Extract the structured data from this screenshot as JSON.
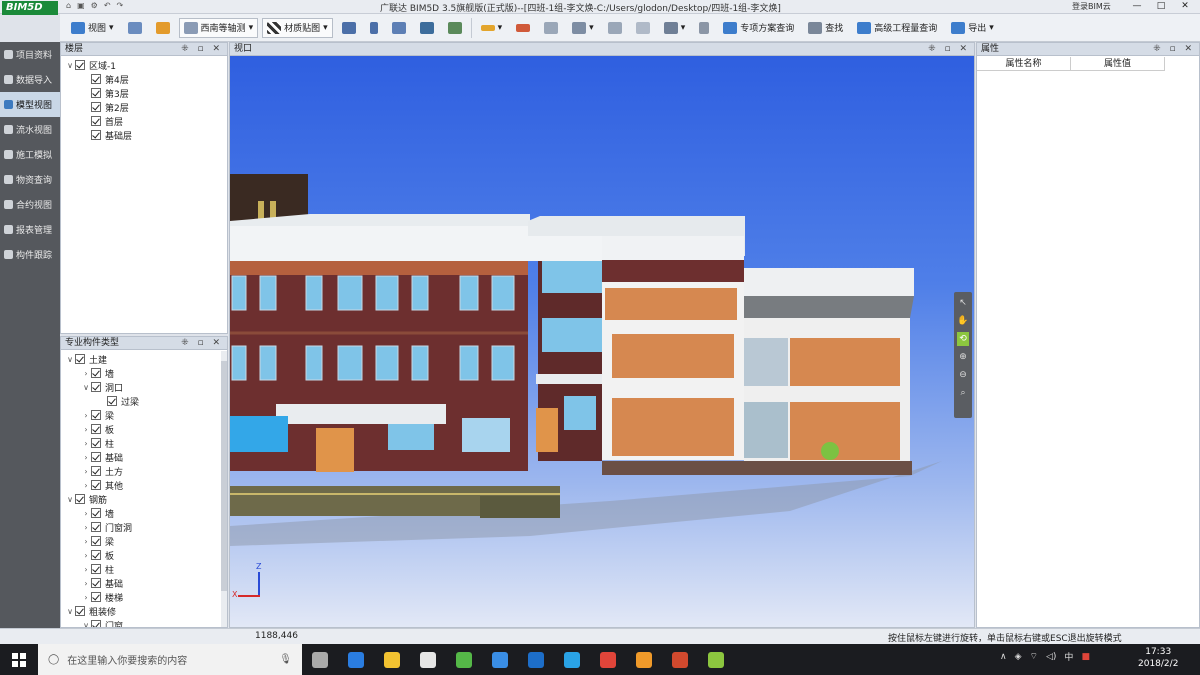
{
  "app": {
    "logo": "BIM5D",
    "window_title": "广联达 BIM5D 3.5旗舰版(正式版)--[四班-1组-李文焕-C:/Users/glodon/Desktop/四班-1组-李文焕]",
    "cloud_login": "登录BIM云",
    "win_controls": [
      "—",
      "□",
      "✕"
    ]
  },
  "toolbar": {
    "view_label": "视图",
    "axis_view": "西南等轴测",
    "material_texture": "材质贴图",
    "special_query": "专项方案查询",
    "find": "查找",
    "advanced_query": "高级工程量查询",
    "export": "导出"
  },
  "left_nav": [
    {
      "label": "项目资料",
      "active": false
    },
    {
      "label": "数据导入",
      "active": false
    },
    {
      "label": "模型视图",
      "active": true
    },
    {
      "label": "流水视图",
      "active": false
    },
    {
      "label": "施工模拟",
      "active": false
    },
    {
      "label": "物资查询",
      "active": false
    },
    {
      "label": "合约视图",
      "active": false
    },
    {
      "label": "报表管理",
      "active": false
    },
    {
      "label": "构件跟踪",
      "active": false
    }
  ],
  "floor_panel": {
    "title": "楼层",
    "controls": "⁜ ▫ ✕",
    "items": [
      {
        "label": "区域-1",
        "level": 0,
        "expand": "∨"
      },
      {
        "label": "第4层",
        "level": 1,
        "expand": ""
      },
      {
        "label": "第3层",
        "level": 1,
        "expand": ""
      },
      {
        "label": "第2层",
        "level": 1,
        "expand": ""
      },
      {
        "label": "首层",
        "level": 1,
        "expand": ""
      },
      {
        "label": "基础层",
        "level": 1,
        "expand": ""
      }
    ]
  },
  "type_panel": {
    "title": "专业构件类型",
    "controls": "⁜ ▫ ✕",
    "items": [
      {
        "label": "土建",
        "level": 0,
        "expand": "∨"
      },
      {
        "label": "墙",
        "level": 1,
        "expand": "›"
      },
      {
        "label": "洞口",
        "level": 1,
        "expand": "∨"
      },
      {
        "label": "过梁",
        "level": 2,
        "expand": ""
      },
      {
        "label": "梁",
        "level": 1,
        "expand": "›"
      },
      {
        "label": "板",
        "level": 1,
        "expand": "›"
      },
      {
        "label": "柱",
        "level": 1,
        "expand": "›"
      },
      {
        "label": "基础",
        "level": 1,
        "expand": "›"
      },
      {
        "label": "土方",
        "level": 1,
        "expand": "›"
      },
      {
        "label": "其他",
        "level": 1,
        "expand": "›"
      },
      {
        "label": "钢筋",
        "level": 0,
        "expand": "∨"
      },
      {
        "label": "墙",
        "level": 1,
        "expand": "›"
      },
      {
        "label": "门窗洞",
        "level": 1,
        "expand": "›"
      },
      {
        "label": "梁",
        "level": 1,
        "expand": "›"
      },
      {
        "label": "板",
        "level": 1,
        "expand": "›"
      },
      {
        "label": "柱",
        "level": 1,
        "expand": "›"
      },
      {
        "label": "基础",
        "level": 1,
        "expand": "›"
      },
      {
        "label": "楼梯",
        "level": 1,
        "expand": "›"
      },
      {
        "label": "粗装修",
        "level": 0,
        "expand": "∨"
      },
      {
        "label": "门窗",
        "level": 1,
        "expand": "∨"
      }
    ]
  },
  "viewport": {
    "title": "视口",
    "controls": "⁜ ▫ ✕",
    "axis_x": "X",
    "axis_z": "Z",
    "nav_tools": [
      "↖",
      "✋",
      "⟲",
      "⊕",
      "⊖",
      "⌕"
    ]
  },
  "property_panel": {
    "title": "属性",
    "controls": "⁜ ▫ ✕",
    "col_name": "属性名称",
    "col_value": "属性值"
  },
  "status": {
    "coords": "1188,446",
    "hint": "按住鼠标左键进行旋转，单击鼠标右键或ESC退出旋转模式"
  },
  "taskbar": {
    "search_placeholder": "在这里输入你要搜索的内容",
    "ime": "中",
    "time": "17:33",
    "date": "2018/2/2",
    "apps": [
      {
        "name": "task-view-app",
        "color": "#aaaaaa"
      },
      {
        "name": "edge-app",
        "color": "#2a7de1"
      },
      {
        "name": "explorer-app",
        "color": "#f2c231"
      },
      {
        "name": "store-app",
        "color": "#e6e6e6"
      },
      {
        "name": "green-app",
        "color": "#55b848"
      },
      {
        "name": "baidu-netdisk-app",
        "color": "#3a8ee6"
      },
      {
        "name": "outlook-app",
        "color": "#1d6ec9"
      },
      {
        "name": "maxthon-app",
        "color": "#2aa3e6"
      },
      {
        "name": "chrome-app",
        "color": "#e0453a"
      },
      {
        "name": "colorful-app",
        "color": "#f09a2a"
      },
      {
        "name": "powerpoint-app",
        "color": "#d1492e"
      },
      {
        "name": "bim5d-app",
        "color": "#8cc63f"
      }
    ]
  }
}
